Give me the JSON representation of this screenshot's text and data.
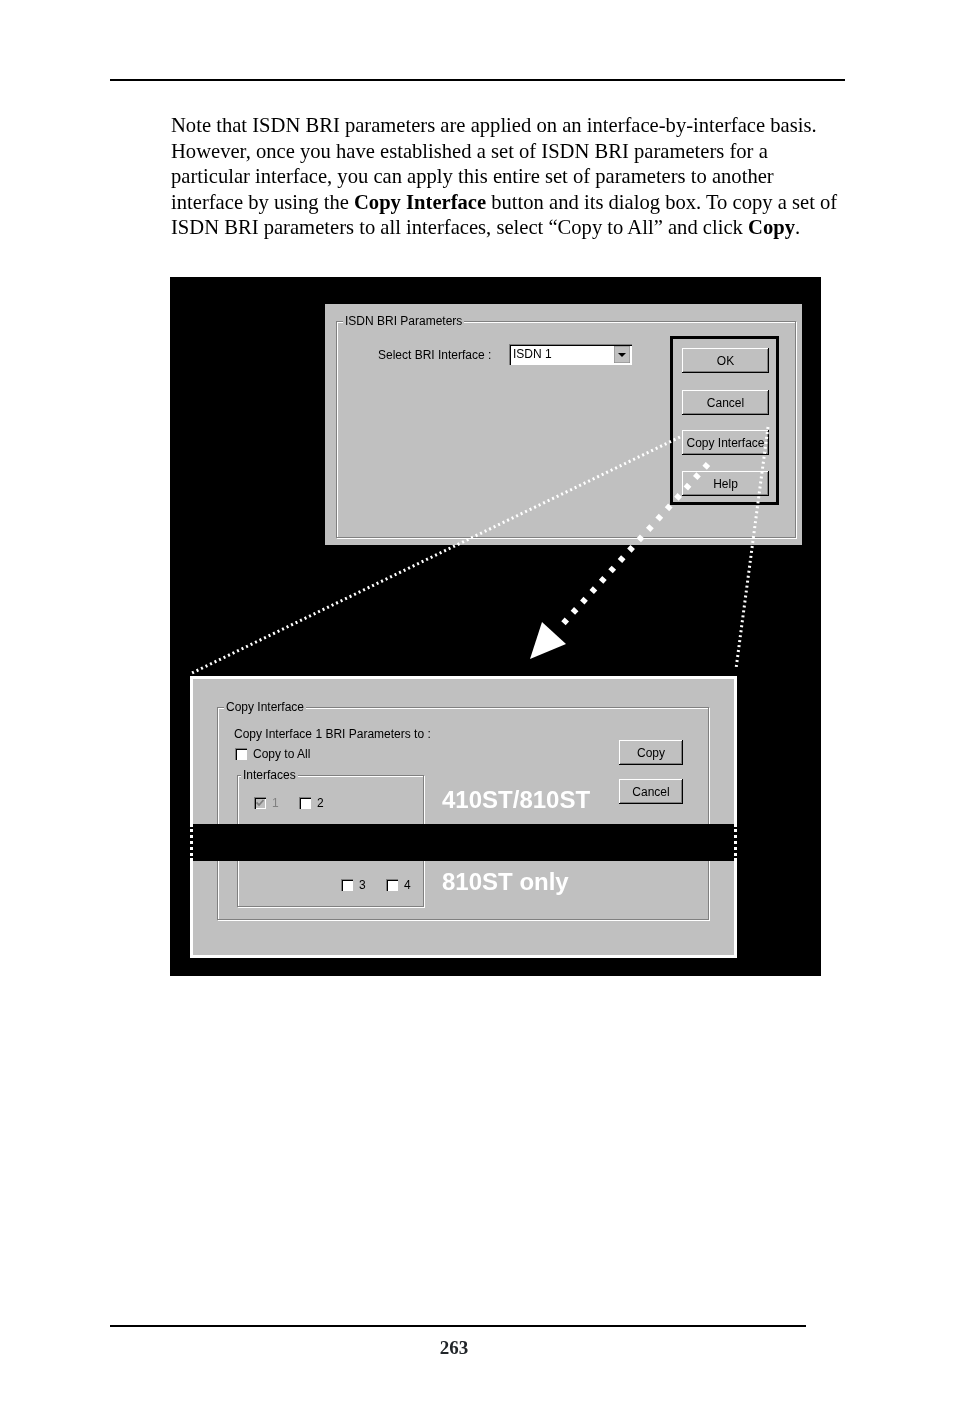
{
  "paragraph": "Note that ISDN BRI parameters are applied on an interface-by-interface basis.  However, once you have established a set of ISDN BRI parameters for a particular interface, you can apply this entire set of parameters to another interface by using the **Copy Interface** button and its dialog box.  To copy a set of ISDN BRI parameters to all interfaces, select “Copy to All” and click **Copy**.",
  "main_dialog": {
    "group_title": "ISDN BRI Parameters",
    "select_label": "Select BRI Interface :",
    "select_value": "ISDN 1",
    "buttons": [
      {
        "label": "OK"
      },
      {
        "label": "Cancel"
      },
      {
        "label": "Copy Interface"
      },
      {
        "label": "Help"
      }
    ]
  },
  "copy_dialog": {
    "group_title": "Copy Interface",
    "instruction": "Copy Interface 1 BRI Parameters to :",
    "copy_to_all": {
      "label": "Copy to All",
      "checked": false
    },
    "interfaces_title": "Interfaces",
    "interfaces": [
      {
        "label": "1",
        "checked": true,
        "disabled": true
      },
      {
        "label": "2",
        "checked": false,
        "disabled": false
      },
      {
        "label": "3",
        "checked": false,
        "disabled": false
      },
      {
        "label": "4",
        "checked": false,
        "disabled": false
      }
    ],
    "buttons": [
      {
        "label": "Copy"
      },
      {
        "label": "Cancel"
      }
    ]
  },
  "callouts": [
    {
      "text": "410ST/810ST"
    },
    {
      "text": "810ST only"
    }
  ],
  "page_number": "263"
}
